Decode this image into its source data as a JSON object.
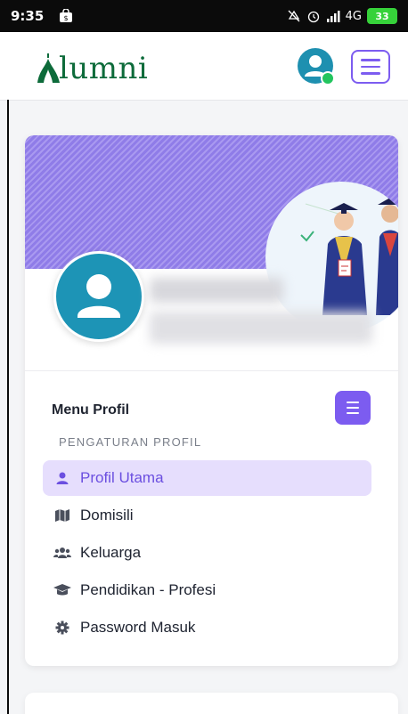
{
  "status_bar": {
    "time": "9:35",
    "network": "4G",
    "battery": "33"
  },
  "header": {
    "logo_text": "lumni"
  },
  "profile": {
    "menu_title": "Menu Profil",
    "section_label": "PENGATURAN PROFIL"
  },
  "menu": {
    "items": [
      {
        "label": "Profil Utama",
        "icon": "user-icon",
        "active": true
      },
      {
        "label": "Domisili",
        "icon": "map-icon",
        "active": false
      },
      {
        "label": "Keluarga",
        "icon": "users-icon",
        "active": false
      },
      {
        "label": "Pendidikan - Profesi",
        "icon": "graduation-cap-icon",
        "active": false
      },
      {
        "label": "Password Masuk",
        "icon": "gear-icon",
        "active": false
      }
    ]
  },
  "colors": {
    "accent": "#7c5cf0",
    "brand_green": "#0d6b3a",
    "avatar_blue": "#1d94b6",
    "active_bg": "#e6defd"
  }
}
